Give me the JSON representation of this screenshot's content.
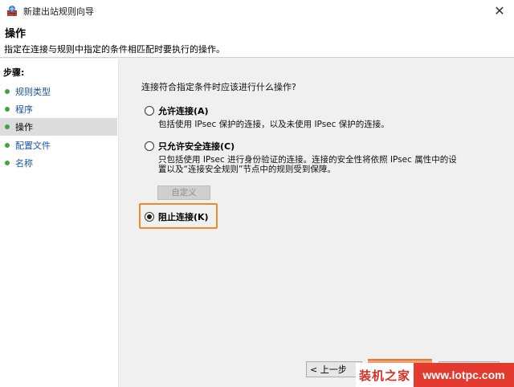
{
  "window": {
    "title": "新建出站规则向导",
    "close_glyph": "✕"
  },
  "header": {
    "title": "操作",
    "description": "指定在连接与规则中指定的条件相匹配时要执行的操作。"
  },
  "sidebar": {
    "steps_title": "步骤:",
    "items": [
      {
        "label": "规则类型",
        "active": false
      },
      {
        "label": "程序",
        "active": false
      },
      {
        "label": "操作",
        "active": true
      },
      {
        "label": "配置文件",
        "active": false
      },
      {
        "label": "名称",
        "active": false
      }
    ]
  },
  "main": {
    "question": "连接符合指定条件时应该进行什么操作?",
    "options": [
      {
        "label": "允许连接(A)",
        "checked": false,
        "description": "包括使用 IPsec 保护的连接，以及未使用 IPsec 保护的连接。"
      },
      {
        "label": "只允许安全连接(C)",
        "checked": false,
        "description_line1": "只包括使用 IPsec 进行身份验证的连接。连接的安全性将依照 IPsec 属性中的设",
        "description_line2": "置以及“连接安全规则”节点中的规则受到保障。"
      },
      {
        "label": "阻止连接(K)",
        "checked": true
      }
    ],
    "customize_button": "自定义",
    "highlight_color": "#f08a24"
  },
  "footer": {
    "back_button": "< 上一步"
  },
  "watermark": {
    "left_text": "装机之家",
    "right_text": "www.lotpc.com"
  },
  "colors": {
    "link": "#1a55a6",
    "step_dot": "#3fa33f",
    "active_step_bg": "#dcdcdc",
    "watermark_red": "#e33b2f"
  }
}
